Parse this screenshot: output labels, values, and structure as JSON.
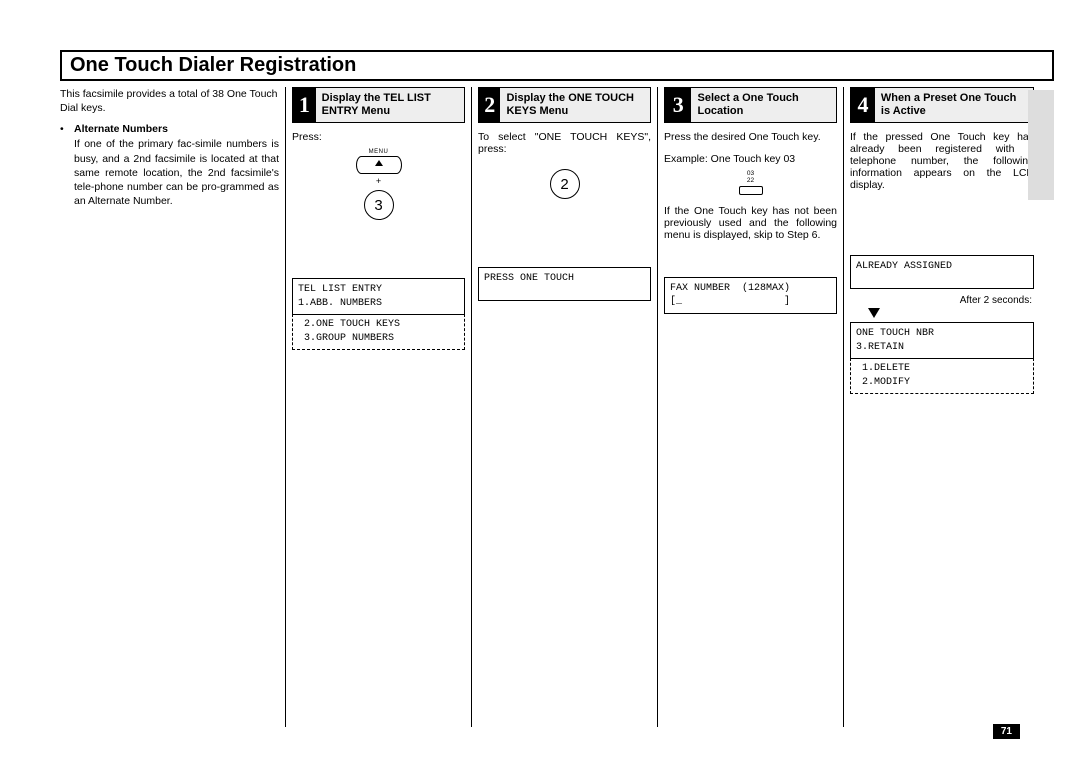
{
  "page": {
    "title": "One Touch Dialer Registration",
    "number": "71"
  },
  "intro": {
    "lead": "This facsimile provides a total of 38 One Touch Dial keys.",
    "bullet_title": "Alternate Numbers",
    "bullet_body": "If one of the primary fac-simile numbers is busy, and a 2nd facsimile is located at that same remote location, the 2nd facsimile's tele-phone number can be pro-grammed as an Alternate Number."
  },
  "step1": {
    "num": "1",
    "title": "Display the TEL LIST ENTRY Menu",
    "press": "Press:",
    "menu_label": "MENU",
    "plus": "+",
    "key_digit": "3",
    "lcd": "TEL LIST ENTRY\n1.ABB. NUMBERS",
    "dashed": " 2.ONE TOUCH KEYS\n 3.GROUP NUMBERS"
  },
  "step2": {
    "num": "2",
    "title": "Display the ONE TOUCH KEYS Menu",
    "instr": "To select \"ONE TOUCH KEYS\", press:",
    "key_digit": "2",
    "lcd": "PRESS ONE TOUCH"
  },
  "step3": {
    "num": "3",
    "title": "Select a One Touch Location",
    "instr": "Press the desired One Touch key.",
    "example_label": "Example:  One Touch key 03",
    "ot_num": "03",
    "ot_sub": "22",
    "note": "If the One Touch key has not been previously used and the following menu is displayed, skip to Step 6.",
    "lcd": "FAX NUMBER  (128MAX)\n[_                 ]"
  },
  "step4": {
    "num": "4",
    "title": "When a Preset One Touch is Active",
    "instr": "If the pressed One Touch key has already been registered with a telephone number, the following information appears on the LCD display.",
    "lcd1": "ALREADY ASSIGNED",
    "after": "After 2 seconds:",
    "lcd2": "ONE TOUCH NBR\n3.RETAIN",
    "dashed": " 1.DELETE\n 2.MODIFY"
  }
}
